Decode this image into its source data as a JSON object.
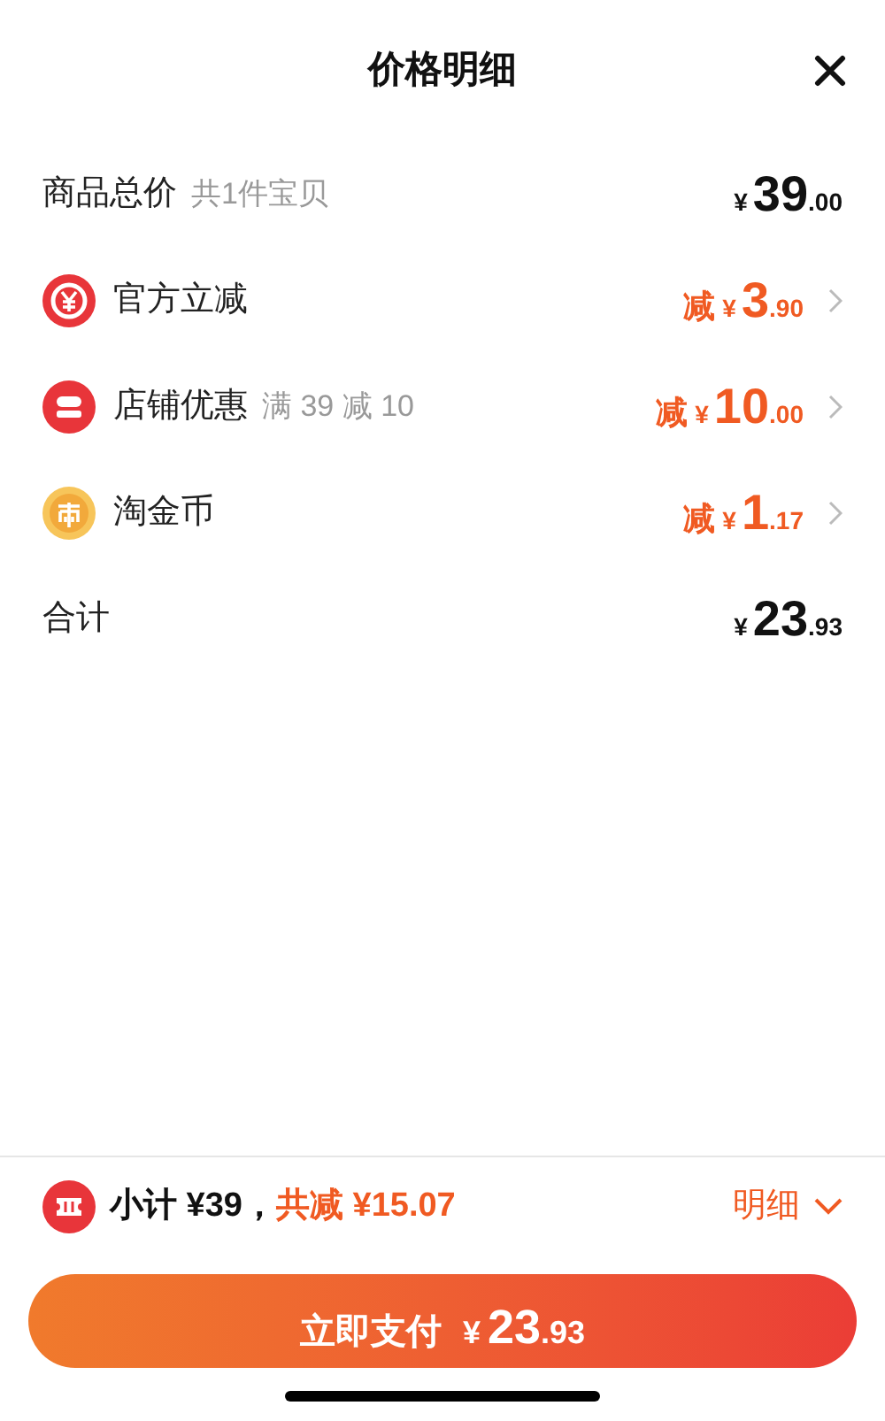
{
  "header": {
    "title": "价格明细"
  },
  "rows": [
    {
      "kind": "plain",
      "label": "商品总价",
      "note": "共1件宝贝",
      "currency": "¥",
      "yuan": "39",
      "fen": ".00"
    },
    {
      "kind": "coupon",
      "label": "官方立减",
      "prefix": "减",
      "currency": "¥",
      "yuan": "3",
      "fen": ".90"
    },
    {
      "kind": "shop",
      "label": "店铺优惠",
      "note": "满 39 减 10",
      "prefix": "减",
      "currency": "¥",
      "yuan": "10",
      "fen": ".00"
    },
    {
      "kind": "coin",
      "label": "淘金币",
      "prefix": "减",
      "currency": "¥",
      "yuan": "1",
      "fen": ".17"
    },
    {
      "kind": "plain",
      "label": "合计",
      "currency": "¥",
      "yuan": "23",
      "fen": ".93"
    }
  ],
  "summary": {
    "subtotal": "小计 ¥39，",
    "saved": "共减 ¥15.07",
    "details": "明细"
  },
  "pay_button": {
    "label": "立即支付",
    "currency": "¥",
    "yuan": "23",
    "fen": ".93"
  }
}
